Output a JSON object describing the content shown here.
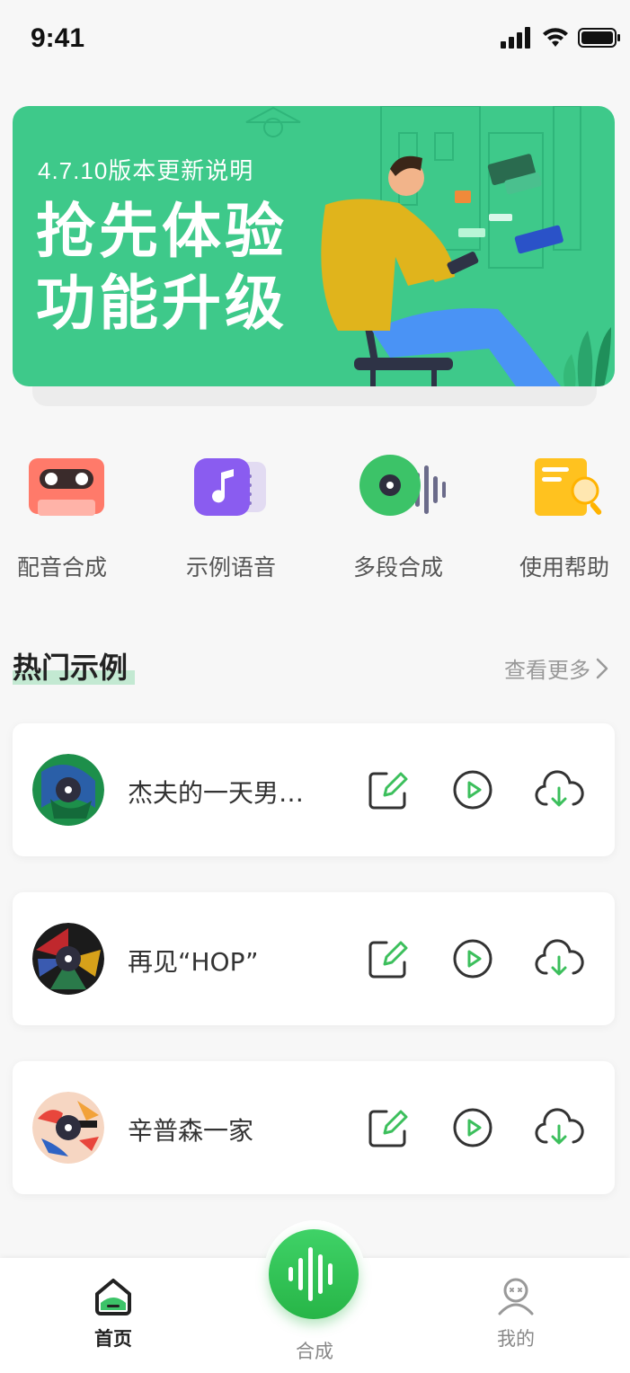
{
  "status": {
    "time": "9:41"
  },
  "banner": {
    "subtitle": "4.7.10版本更新说明",
    "title_line1": "抢先体验",
    "title_line2": "功能升级"
  },
  "quick_actions": [
    {
      "label": "配音合成",
      "icon": "cassette-icon"
    },
    {
      "label": "示例语音",
      "icon": "music-note-icon"
    },
    {
      "label": "多段合成",
      "icon": "record-waveform-icon"
    },
    {
      "label": "使用帮助",
      "icon": "document-search-icon"
    }
  ],
  "section": {
    "title": "热门示例",
    "more_label": "查看更多"
  },
  "examples": [
    {
      "title": "杰夫的一天男…"
    },
    {
      "title": "再见“HOP”"
    },
    {
      "title": "辛普森一家"
    }
  ],
  "tabs": {
    "home": "首页",
    "synth": "合成",
    "mine": "我的"
  },
  "colors": {
    "accent": "#3ec98a",
    "fab": "#2fc257",
    "banner_bg": "#3ec98a"
  }
}
